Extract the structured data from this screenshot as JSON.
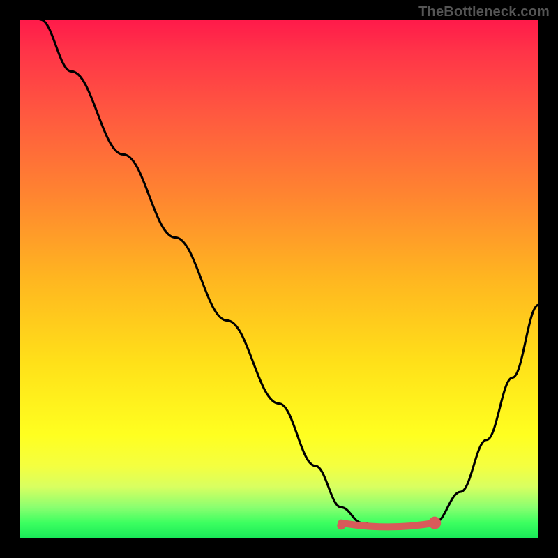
{
  "watermark": "TheBottleneck.com",
  "chart_data": {
    "type": "line",
    "title": "",
    "xlabel": "",
    "ylabel": "",
    "xlim": [
      0,
      100
    ],
    "ylim": [
      0,
      100
    ],
    "series": [
      {
        "name": "bottleneck-curve",
        "x": [
          4,
          10,
          20,
          30,
          40,
          50,
          57,
          62,
          66,
          70,
          75,
          80,
          85,
          90,
          95,
          100
        ],
        "y": [
          100,
          90,
          74,
          58,
          42,
          26,
          14,
          6,
          3,
          2,
          2,
          3,
          9,
          19,
          31,
          45
        ]
      }
    ],
    "markers": [
      {
        "name": "valley-marker-left",
        "x": 62,
        "y": 2.5,
        "color": "#d95a5a",
        "r": 6
      },
      {
        "name": "valley-marker-right",
        "x": 80,
        "y": 3.0,
        "color": "#d95a5a",
        "r": 9
      }
    ],
    "valley_segment": {
      "color": "#d95a5a",
      "width": 10,
      "x_start": 62,
      "x_end": 80,
      "y": 2
    }
  }
}
